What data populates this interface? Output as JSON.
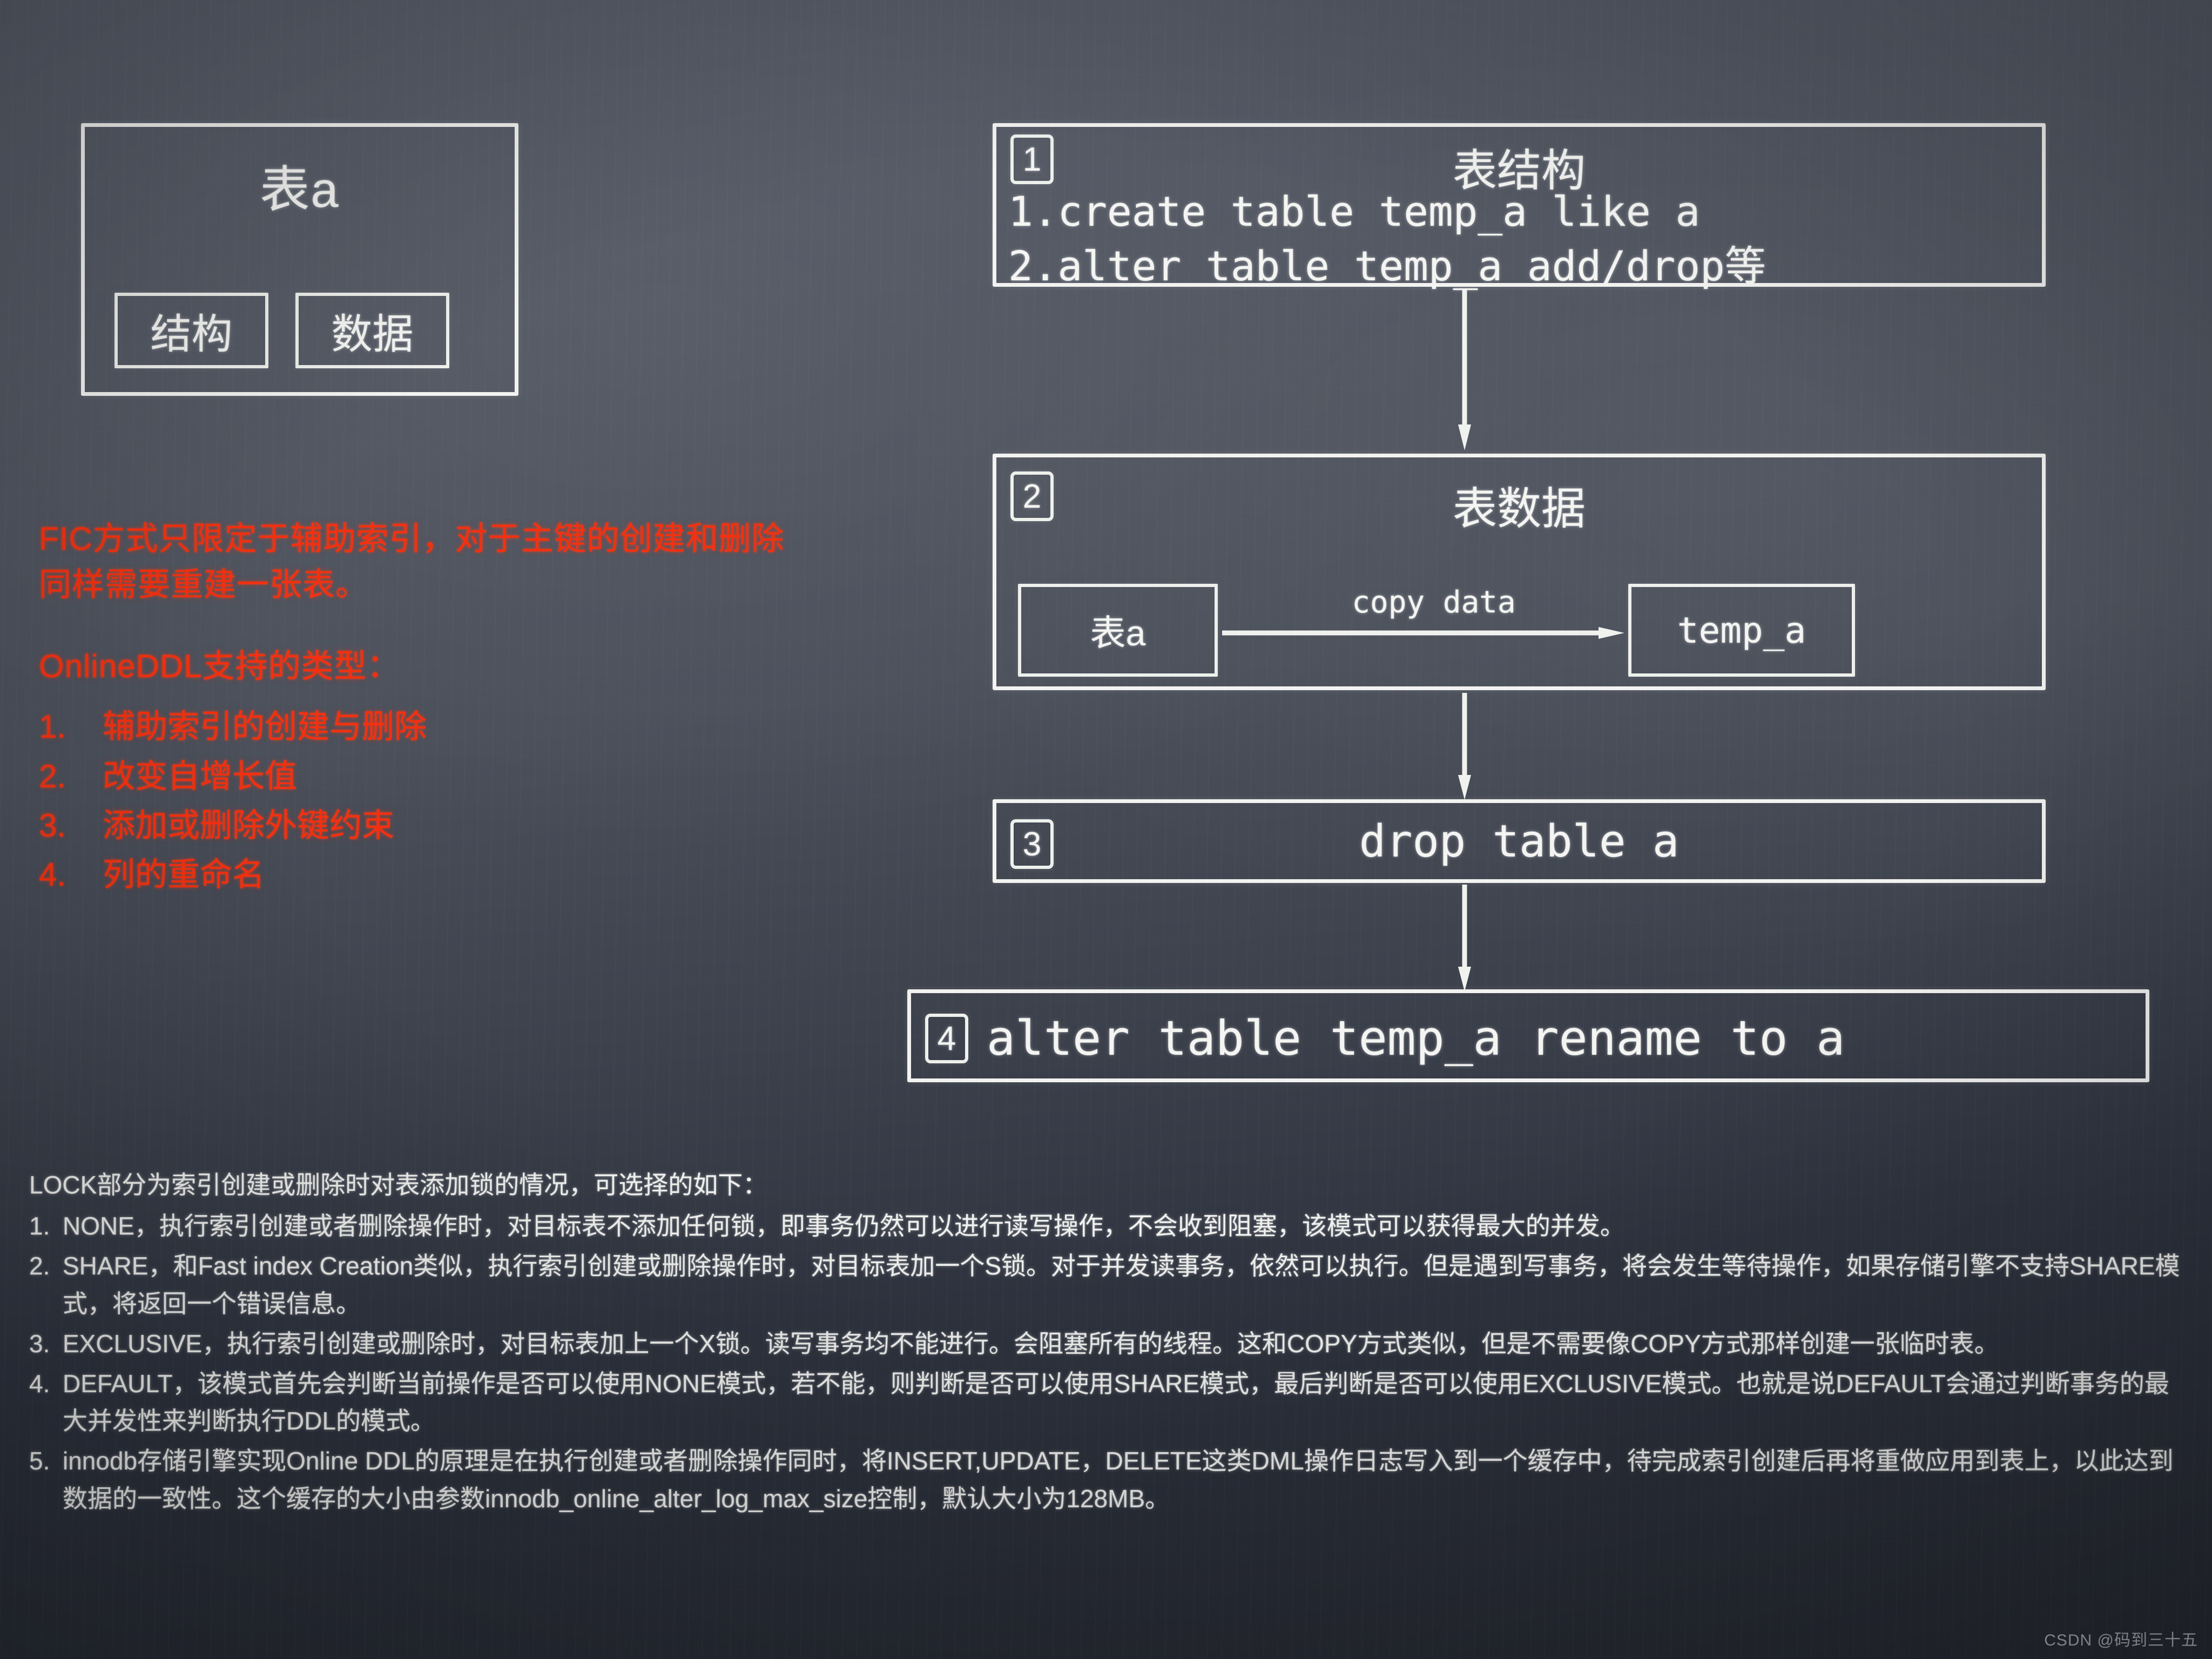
{
  "table_panel": {
    "title": "表a",
    "sub_structure": "结构",
    "sub_data": "数据"
  },
  "red_notes": {
    "paragraph": "FIC方式只限定于辅助索引，对于主键的创建和删除同样需要重建一张表。",
    "heading": "OnlineDDL支持的类型：",
    "items": [
      {
        "num": "1.",
        "text": "辅助索引的创建与删除"
      },
      {
        "num": "2.",
        "text": "改变自增长值"
      },
      {
        "num": "3.",
        "text": "添加或删除外键约束"
      },
      {
        "num": "4.",
        "text": "列的重命名"
      }
    ],
    "color": "#f4300f"
  },
  "flow": {
    "step1": {
      "num": "1",
      "title": "表结构",
      "line1": "1.create table temp_a like a",
      "line2": "2.alter table temp_a add/drop等"
    },
    "step2": {
      "num": "2",
      "title": "表数据",
      "source_box": "表a",
      "target_box": "temp_a",
      "arrow_label": "copy data"
    },
    "step3": {
      "num": "3",
      "text": "drop table a"
    },
    "step4": {
      "num": "4",
      "text": "alter table temp_a rename to a"
    }
  },
  "bottom_notes": {
    "lead": "LOCK部分为索引创建或删除时对表添加锁的情况，可选择的如下：",
    "items": [
      {
        "num": "1.",
        "text": "NONE，执行索引创建或者删除操作时，对目标表不添加任何锁，即事务仍然可以进行读写操作，不会收到阻塞，该模式可以获得最大的并发。"
      },
      {
        "num": "2.",
        "text": "SHARE，和Fast index Creation类似，执行索引创建或删除操作时，对目标表加一个S锁。对于并发读事务，依然可以执行。但是遇到写事务，将会发生等待操作，如果存储引擎不支持SHARE模式，将返回一个错误信息。"
      },
      {
        "num": "3.",
        "text": "EXCLUSIVE，执行索引创建或删除时，对目标表加上一个X锁。读写事务均不能进行。会阻塞所有的线程。这和COPY方式类似，但是不需要像COPY方式那样创建一张临时表。"
      },
      {
        "num": "4.",
        "text": "DEFAULT，该模式首先会判断当前操作是否可以使用NONE模式，若不能，则判断是否可以使用SHARE模式，最后判断是否可以使用EXCLUSIVE模式。也就是说DEFAULT会通过判断事务的最大并发性来判断执行DDL的模式。"
      },
      {
        "num": "5.",
        "text": "innodb存储引擎实现Online DDL的原理是在执行创建或者删除操作同时，将INSERT,UPDATE，DELETE这类DML操作日志写入到一个缓存中，待完成索引创建后再将重做应用到表上，以此达到数据的一致性。这个缓存的大小由参数innodb_online_alter_log_max_size控制，默认大小为128MB。"
      }
    ]
  },
  "watermark": "CSDN @码到三十五"
}
